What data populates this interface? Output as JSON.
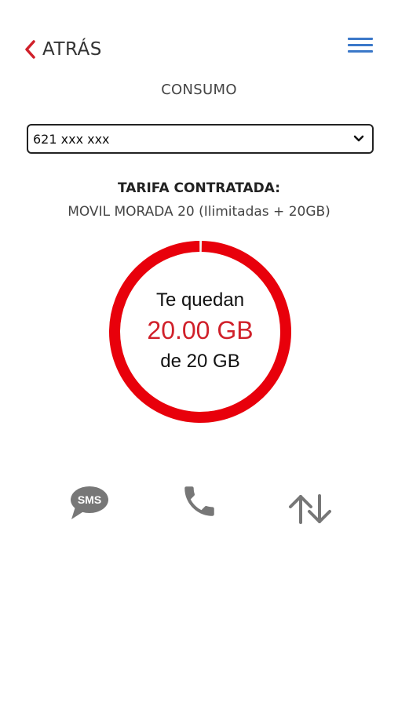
{
  "header": {
    "back_label": "ATRÁS",
    "back_icon": "chevron-left-icon",
    "menu_icon": "hamburger-menu-icon"
  },
  "page": {
    "title": "CONSUMO"
  },
  "line_selector": {
    "selected_value": "621 xxx xxx"
  },
  "tariff": {
    "label": "TARIFA CONTRATADA:",
    "name": "MOVIL MORADA 20 (Ilimitadas + 20GB)"
  },
  "data_gauge": {
    "line1": "Te quedan",
    "remaining": "20.00 GB",
    "line3": "de 20 GB",
    "remaining_fraction": 1.0
  },
  "bottom_nav": {
    "sms_label": "SMS",
    "sms_icon": "sms-bubble-icon",
    "call_icon": "phone-icon",
    "data_icon": "data-transfer-arrows-icon"
  },
  "colors": {
    "accent_red": "#e8000b",
    "menu_blue": "#3b78c9",
    "icon_gray": "#777777",
    "text_dark": "#333333"
  }
}
